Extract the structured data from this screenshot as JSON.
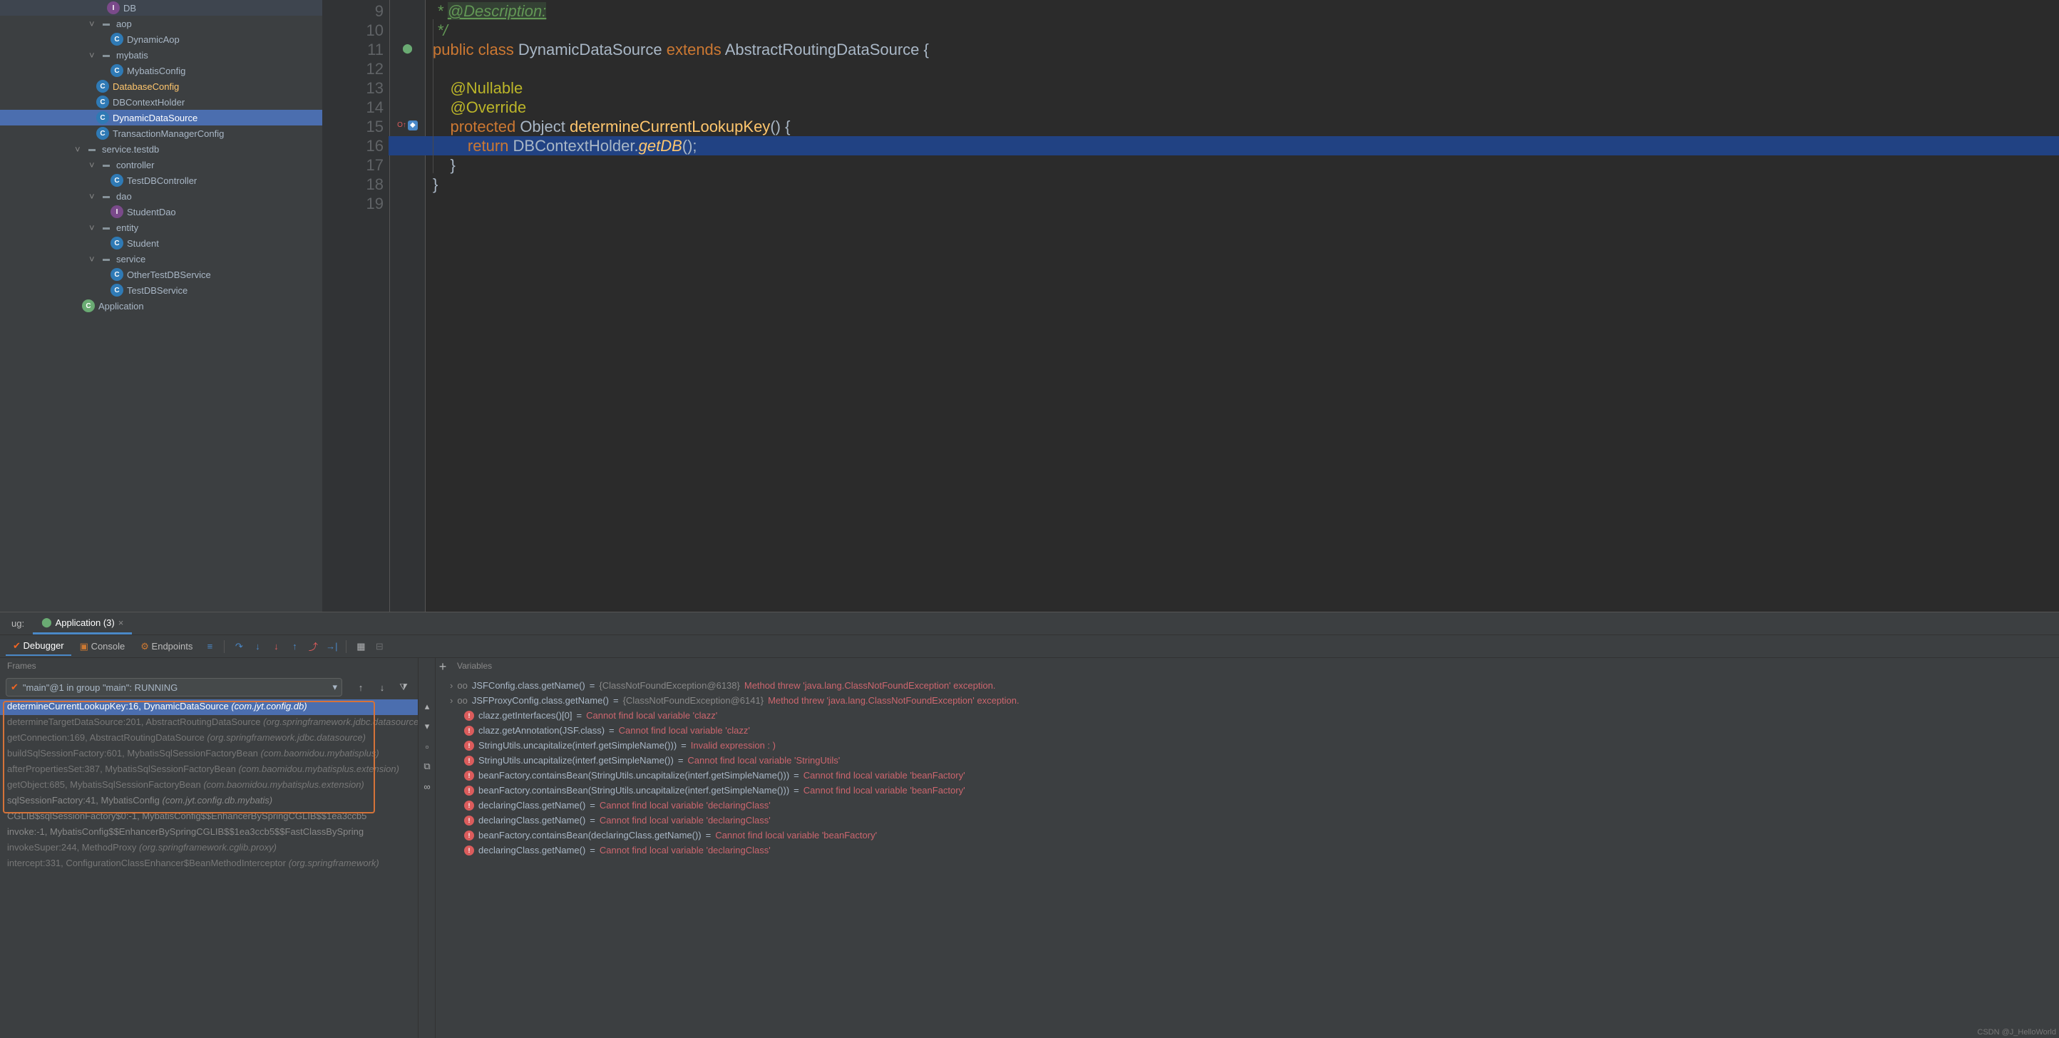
{
  "tree": {
    "db": "DB",
    "aop": "aop",
    "dynamicAop": "DynamicAop",
    "mybatis": "mybatis",
    "mybatisConfig": "MybatisConfig",
    "databaseConfig": "DatabaseConfig",
    "dbContextHolder": "DBContextHolder",
    "dynamicDataSource": "DynamicDataSource",
    "transactionManagerConfig": "TransactionManagerConfig",
    "serviceTestdb": "service.testdb",
    "controller": "controller",
    "testDbController": "TestDBController",
    "dao": "dao",
    "studentDao": "StudentDao",
    "entity": "entity",
    "student": "Student",
    "service": "service",
    "otherTestDbService": "OtherTestDBService",
    "testDbService": "TestDBService",
    "application": "Application"
  },
  "gutter": {
    "start": 9,
    "end": 19
  },
  "code": {
    "l9_tag": "@Description:",
    "l9_pre": " * ",
    "l10": " */",
    "l11": "public class DynamicDataSource extends AbstractRoutingDataSource {",
    "l11_parts": {
      "kw1": "public",
      "kw2": "class",
      "name": "DynamicDataSource",
      "kw3": "extends",
      "sup": "AbstractRoutingDataSource",
      "brace": "{"
    },
    "l12": "",
    "l13": "    @Nullable",
    "l14": "    @Override",
    "l15_parts": {
      "kw1": "protected",
      "type": "Object",
      "name": "determineCurrentLookupKey",
      "sig": "() {"
    },
    "l16_parts": {
      "kw": "return",
      "obj": "DBContextHolder.",
      "call": "getDB",
      "end": "();"
    },
    "l17": "    }",
    "l18": "}"
  },
  "debug": {
    "tabLabel": "ug:",
    "appTab": "Application (3)",
    "debuggerTab": "Debugger",
    "consoleTab": "Console",
    "endpointsTab": "Endpoints",
    "framesHeader": "Frames",
    "threadSelect": "\"main\"@1 in group \"main\": RUNNING",
    "varsHeader": "Variables",
    "nav": {
      "up": "↑",
      "down": "↓",
      "filter": "▾",
      "plus": "+"
    }
  },
  "frames": [
    {
      "txt": "determineCurrentLookupKey:16, DynamicDataSource",
      "pkg": "(com.jyt.config.db)",
      "sel": true,
      "lib": false
    },
    {
      "txt": "determineTargetDataSource:201, AbstractRoutingDataSource",
      "pkg": "(org.springframework.jdbc.datasource)",
      "lib": true
    },
    {
      "txt": "getConnection:169, AbstractRoutingDataSource",
      "pkg": "(org.springframework.jdbc.datasource)",
      "lib": true
    },
    {
      "txt": "buildSqlSessionFactory:601, MybatisSqlSessionFactoryBean",
      "pkg": "(com.baomidou.mybatisplus)",
      "lib": true
    },
    {
      "txt": "afterPropertiesSet:387, MybatisSqlSessionFactoryBean",
      "pkg": "(com.baomidou.mybatisplus.extension)",
      "lib": true
    },
    {
      "txt": "getObject:685, MybatisSqlSessionFactoryBean",
      "pkg": "(com.baomidou.mybatisplus.extension)",
      "lib": true
    },
    {
      "txt": "sqlSessionFactory:41, MybatisConfig",
      "pkg": "(com.jyt.config.db.mybatis)",
      "lib": false
    },
    {
      "txt": "CGLIB$sqlSessionFactory$0:-1, MybatisConfig$$EnhancerBySpringCGLIB$$1ea3ccb5",
      "pkg": "",
      "lib": false
    },
    {
      "txt": "invoke:-1, MybatisConfig$$EnhancerBySpringCGLIB$$1ea3ccb5$$FastClassBySpring",
      "pkg": "",
      "lib": false
    },
    {
      "txt": "invokeSuper:244, MethodProxy",
      "pkg": "(org.springframework.cglib.proxy)",
      "lib": true
    },
    {
      "txt": "intercept:331, ConfigurationClassEnhancer$BeanMethodInterceptor",
      "pkg": "(org.springframework)",
      "lib": true
    }
  ],
  "vars": [
    {
      "type": "expr",
      "arrow": true,
      "name": "JSFConfig.class.getName()",
      "eq": " = ",
      "cls": "{ClassNotFoundException@6138}",
      "err": "Method threw 'java.lang.ClassNotFoundException' exception."
    },
    {
      "type": "expr",
      "arrow": true,
      "name": "JSFProxyConfig.class.getName()",
      "eq": " = ",
      "cls": "{ClassNotFoundException@6141}",
      "err": "Method threw 'java.lang.ClassNotFoundException' exception."
    },
    {
      "type": "err",
      "name": "clazz.getInterfaces()[0]",
      "eq": " = ",
      "err": "Cannot find local variable 'clazz'"
    },
    {
      "type": "err",
      "name": "clazz.getAnnotation(JSF.class)",
      "eq": " = ",
      "err": "Cannot find local variable 'clazz'"
    },
    {
      "type": "err",
      "name": "StringUtils.uncapitalize(interf.getSimpleName()))",
      "eq": " = ",
      "err": "Invalid expression : )"
    },
    {
      "type": "err",
      "name": "StringUtils.uncapitalize(interf.getSimpleName())",
      "eq": " = ",
      "err": "Cannot find local variable 'StringUtils'"
    },
    {
      "type": "err",
      "name": "beanFactory.containsBean(StringUtils.uncapitalize(interf.getSimpleName()))",
      "eq": " = ",
      "err": "Cannot find local variable 'beanFactory'"
    },
    {
      "type": "err",
      "name": "beanFactory.containsBean(StringUtils.uncapitalize(interf.getSimpleName()))",
      "eq": " = ",
      "err": "Cannot find local variable 'beanFactory'"
    },
    {
      "type": "err",
      "name": "declaringClass.getName()",
      "eq": " = ",
      "err": "Cannot find local variable 'declaringClass'"
    },
    {
      "type": "err",
      "name": "declaringClass.getName()",
      "eq": " = ",
      "err": "Cannot find local variable 'declaringClass'"
    },
    {
      "type": "err",
      "name": "beanFactory.containsBean(declaringClass.getName())",
      "eq": " = ",
      "err": "Cannot find local variable 'beanFactory'"
    },
    {
      "type": "err",
      "name": "declaringClass.getName()",
      "eq": " = ",
      "err": "Cannot find local variable 'declaringClass'"
    }
  ],
  "watermark": "CSDN @J_HelloWorld"
}
